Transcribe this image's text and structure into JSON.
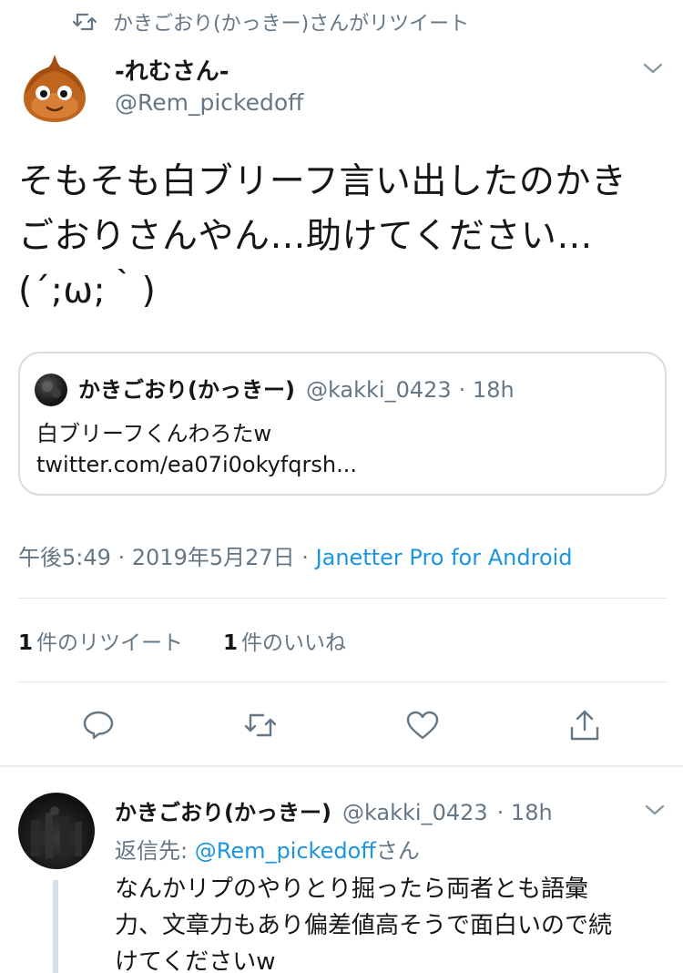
{
  "retweet_header": {
    "text": "かきごおり(かっきー)さんがリツイート",
    "icon": "retweet-icon"
  },
  "tweet": {
    "author_name": "-れむさん-",
    "author_handle": "@Rem_pickedoff",
    "avatar_icon": "onion-character-avatar",
    "text": "そもそも白ブリーフ言い出したのかき\nごおりさんやん…助けてください…\n(´;ω;｀)",
    "quoted": {
      "name": "かきごおり(かっきー)",
      "handle": "@kakki_0423",
      "time": "· 18h",
      "line1": "白ブリーフくんわろたw",
      "line2": "twitter.com/ea07i0okyfqrsh..."
    },
    "time_date": "午後5:49 · 2019年5月27日 · ",
    "source": "Janetter Pro for Android",
    "stats": {
      "retweets_count": "1",
      "retweets_label": "件のリツイート",
      "likes_count": "1",
      "likes_label": "件のいいね"
    },
    "actions": [
      "reply-icon",
      "retweet-icon",
      "like-icon",
      "share-icon"
    ]
  },
  "reply": {
    "name": "かきごおり(かっきー)",
    "handle": "@kakki_0423",
    "time": "· 18h",
    "reply_to_prefix": "返信先: ",
    "reply_to_handle": "@Rem_pickedoff",
    "reply_to_suffix": "さん",
    "text": "なんかリプのやりとり掘ったら両者とも語彙\n力、文章力もあり偏差値高そうで面白いので続\nけてくださいw"
  },
  "colors": {
    "accent": "#1b95e0",
    "secondary_text": "#657786",
    "border": "#e1e8ed"
  }
}
